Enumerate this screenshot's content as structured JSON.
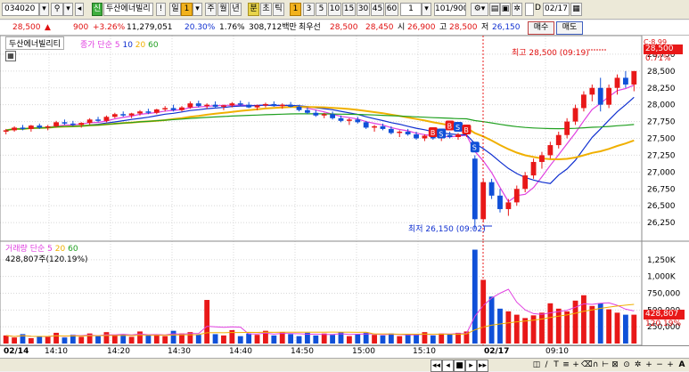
{
  "toolbar": {
    "code": "034020",
    "credit": "신",
    "name": "두산에너빌리",
    "excl": "!",
    "periods": [
      "일",
      "주",
      "월",
      "년",
      "분",
      "초",
      "틱"
    ],
    "active_period": "일",
    "minute_unit": "분",
    "intervals": [
      "1",
      "3",
      "5",
      "10",
      "15",
      "30",
      "45",
      "60"
    ],
    "active_interval": "1",
    "count_value": "1",
    "page": "101/900",
    "date_check": "D",
    "date_value": "02/17"
  },
  "infobar": {
    "price": "28,500",
    "arrow": "▲",
    "change": "900",
    "change_pct": "+3.26%",
    "volume": "11,279,051",
    "vol_ratio": "20.30%",
    "turnover": "1.76%",
    "amount": "308,712백만",
    "best_label": "최우선",
    "best_ask": "28,500",
    "best_bid": "28,450",
    "open_label": "시",
    "open": "26,900",
    "high_label": "고",
    "high": "28,500",
    "low_label": "저",
    "low": "26,150",
    "buy_button": "매수",
    "sell_button": "매도"
  },
  "chart": {
    "legend_name": "두산에너빌리티",
    "legend_type": "종가 단순",
    "ma_periods": [
      "5",
      "10",
      "20",
      "60"
    ],
    "ma_colors": [
      "#e040e0",
      "#1030d0",
      "#f0b000",
      "#20a020"
    ],
    "high_annotation": "최고 28,500 (09:19)",
    "low_annotation": "최저 26,150 (09:02)",
    "current_price_tag": "28,500",
    "tag_pct": "0.71%",
    "price_ticks": [
      "28,750",
      "28,500",
      "28,250",
      "28,000",
      "27,750",
      "27,500",
      "27,250",
      "27,000",
      "26,750",
      "26,500",
      "26,250"
    ],
    "top_tick": "C:8.99",
    "volume_legend_name": "거래량",
    "volume_legend_type": "단순",
    "volume_ma_periods": [
      "5",
      "20",
      "60"
    ],
    "volume_info": "428,807주(120.19%)",
    "volume_ticks": [
      "1,250K",
      "1,000K",
      "750,000",
      "500,000",
      "250,000"
    ],
    "volume_tag": "428,807",
    "volume_tag_pct": "120.19%",
    "signal_marks": [
      "B",
      "B",
      "S",
      "S",
      "B"
    ],
    "sell_signal": "S",
    "colors": {
      "up": "#e81818",
      "down": "#1050d8",
      "grid": "#d8d8d8"
    }
  },
  "chart_data": {
    "type": "candlestick",
    "x_labels": [
      "02/14",
      "14:10",
      "14:20",
      "14:30",
      "14:40",
      "14:50",
      "15:00",
      "15:10",
      "02/17",
      "09:10"
    ],
    "y_label": "",
    "ylim": [
      26000,
      29000
    ],
    "price_series": [
      [
        27600,
        27640,
        27560,
        27620
      ],
      [
        27620,
        27680,
        27600,
        27660
      ],
      [
        27660,
        27700,
        27620,
        27640
      ],
      [
        27640,
        27700,
        27600,
        27690
      ],
      [
        27690,
        27720,
        27640,
        27660
      ],
      [
        27660,
        27700,
        27620,
        27680
      ],
      [
        27680,
        27760,
        27660,
        27740
      ],
      [
        27740,
        27780,
        27700,
        27720
      ],
      [
        27720,
        27760,
        27680,
        27700
      ],
      [
        27700,
        27740,
        27660,
        27730
      ],
      [
        27730,
        27800,
        27700,
        27780
      ],
      [
        27780,
        27820,
        27740,
        27760
      ],
      [
        27760,
        27840,
        27740,
        27820
      ],
      [
        27820,
        27880,
        27800,
        27860
      ],
      [
        27860,
        27900,
        27820,
        27840
      ],
      [
        27840,
        27880,
        27800,
        27870
      ],
      [
        27870,
        27920,
        27840,
        27900
      ],
      [
        27900,
        27940,
        27860,
        27880
      ],
      [
        27880,
        27940,
        27860,
        27930
      ],
      [
        27930,
        27980,
        27900,
        27950
      ],
      [
        27950,
        28000,
        27900,
        27920
      ],
      [
        27920,
        27980,
        27900,
        27960
      ],
      [
        27960,
        28050,
        27940,
        28020
      ],
      [
        28020,
        28060,
        27960,
        27980
      ],
      [
        27980,
        28020,
        27940,
        28000
      ],
      [
        28000,
        28050,
        27960,
        27970
      ],
      [
        27970,
        28000,
        27920,
        27990
      ],
      [
        27990,
        28040,
        27960,
        28020
      ],
      [
        28020,
        28060,
        27980,
        28000
      ],
      [
        28000,
        28040,
        27950,
        27960
      ],
      [
        27960,
        28000,
        27920,
        27990
      ],
      [
        27990,
        28030,
        27960,
        28010
      ],
      [
        28010,
        28050,
        27970,
        27980
      ],
      [
        27980,
        28020,
        27940,
        28000
      ],
      [
        28000,
        28040,
        27960,
        27970
      ],
      [
        27970,
        28000,
        27900,
        27920
      ],
      [
        27920,
        27960,
        27860,
        27880
      ],
      [
        27880,
        27920,
        27820,
        27840
      ],
      [
        27840,
        27880,
        27800,
        27860
      ],
      [
        27860,
        27900,
        27780,
        27800
      ],
      [
        27800,
        27840,
        27740,
        27760
      ],
      [
        27760,
        27800,
        27700,
        27780
      ],
      [
        27780,
        27820,
        27720,
        27740
      ],
      [
        27740,
        27760,
        27640,
        27660
      ],
      [
        27660,
        27700,
        27600,
        27680
      ],
      [
        27680,
        27720,
        27620,
        27640
      ],
      [
        27640,
        27680,
        27560,
        27580
      ],
      [
        27580,
        27620,
        27520,
        27600
      ],
      [
        27600,
        27640,
        27540,
        27560
      ],
      [
        27560,
        27600,
        27480,
        27500
      ],
      [
        27500,
        27560,
        27460,
        27540
      ],
      [
        27540,
        27580,
        27480,
        27500
      ],
      [
        27500,
        27560,
        27460,
        27550
      ],
      [
        27550,
        27600,
        27500,
        27520
      ],
      [
        27520,
        27580,
        27480,
        27560
      ],
      [
        27560,
        27600,
        27520,
        27600
      ],
      [
        27200,
        27250,
        26150,
        26300
      ],
      [
        26300,
        26900,
        26250,
        26850
      ],
      [
        26850,
        26900,
        26600,
        26650
      ],
      [
        26650,
        26750,
        26400,
        26450
      ],
      [
        26450,
        26600,
        26350,
        26550
      ],
      [
        26550,
        26800,
        26500,
        26750
      ],
      [
        26750,
        27000,
        26700,
        26950
      ],
      [
        26950,
        27200,
        26900,
        27150
      ],
      [
        27150,
        27300,
        27050,
        27250
      ],
      [
        27250,
        27450,
        27200,
        27400
      ],
      [
        27400,
        27600,
        27350,
        27550
      ],
      [
        27550,
        27800,
        27500,
        27750
      ],
      [
        27750,
        28000,
        27700,
        27950
      ],
      [
        27950,
        28200,
        27900,
        28150
      ],
      [
        28150,
        28300,
        28050,
        28250
      ],
      [
        28250,
        28400,
        27900,
        28000
      ],
      [
        28000,
        28300,
        27950,
        28250
      ],
      [
        28250,
        28450,
        28150,
        28400
      ],
      [
        28400,
        28500,
        28250,
        28300
      ],
      [
        28300,
        28500,
        28200,
        28500
      ]
    ],
    "volume_series": [
      120,
      90,
      140,
      80,
      100,
      110,
      160,
      90,
      130,
      100,
      150,
      110,
      170,
      120,
      140,
      100,
      180,
      120,
      130,
      110,
      190,
      150,
      170,
      130,
      650,
      140,
      120,
      200,
      110,
      150,
      130,
      190,
      120,
      170,
      140,
      110,
      160,
      120,
      150,
      130,
      170,
      110,
      140,
      160,
      130,
      120,
      150,
      110,
      140,
      130,
      170,
      120,
      150,
      140,
      160,
      180,
      1400,
      950,
      700,
      520,
      480,
      430,
      380,
      420,
      460,
      600,
      520,
      480,
      640,
      720,
      560,
      600,
      510,
      460,
      430,
      430
    ]
  }
}
